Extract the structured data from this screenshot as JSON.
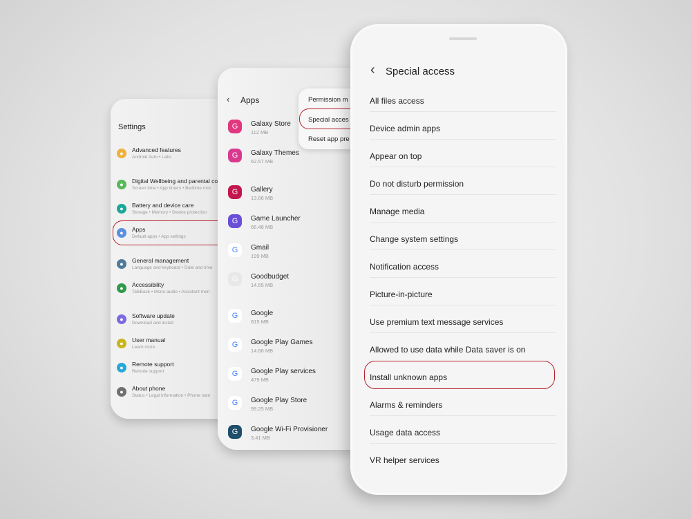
{
  "settings": {
    "title": "Settings",
    "items": [
      {
        "label": "Advanced features",
        "sub": "Android Auto  •  Labs",
        "color": "#f0b13c",
        "icon": "gear-plus-icon"
      },
      {
        "label": "Digital Wellbeing and parental co",
        "sub": "Screen time  •  App timers  •  Bedtime moc",
        "color": "#5bb85d",
        "icon": "wellbeing-icon"
      },
      {
        "label": "Battery and device care",
        "sub": "Storage  •  Memory  •  Device protection",
        "color": "#1aa89a",
        "icon": "battery-care-icon"
      },
      {
        "label": "Apps",
        "sub": "Default apps  •  App settings",
        "color": "#5b8fe0",
        "icon": "apps-grid-icon"
      },
      {
        "label": "General management",
        "sub": "Language and keyboard  •  Date and time",
        "color": "#4f7a99",
        "icon": "sliders-icon"
      },
      {
        "label": "Accessibility",
        "sub": "TalkBack  •  Mono audio  •  Assistant men",
        "color": "#2e9a4a",
        "icon": "accessibility-icon"
      },
      {
        "label": "Software update",
        "sub": "Download and install",
        "color": "#7a6be0",
        "icon": "software-update-icon"
      },
      {
        "label": "User manual",
        "sub": "Learn more",
        "color": "#c9b51e",
        "icon": "manual-icon"
      },
      {
        "label": "Remote support",
        "sub": "Remote support",
        "color": "#27a9d8",
        "icon": "headset-icon"
      },
      {
        "label": "About phone",
        "sub": "Status  •  Legal information  •  Phone nam",
        "color": "#707070",
        "icon": "info-icon"
      }
    ]
  },
  "apps": {
    "title": "Apps",
    "menu": [
      "Permission m",
      "Special acces",
      "Reset app pre"
    ],
    "items": [
      {
        "label": "Galaxy Store",
        "size": "112 MB",
        "color": "#e2367f",
        "icon": "bag-icon"
      },
      {
        "label": "Galaxy Themes",
        "size": "62.57 MB",
        "color": "#d93a90",
        "icon": "brush-icon"
      },
      {
        "label": "Gallery",
        "size": "13.66 MB",
        "color": "#c4164f",
        "icon": "flower-icon"
      },
      {
        "label": "Game Launcher",
        "size": "66.48 MB",
        "color": "#6b4fd8",
        "icon": "game-icon"
      },
      {
        "label": "Gmail",
        "size": "199 MB",
        "color": "#ffffff",
        "icon": "gmail-icon"
      },
      {
        "label": "Goodbudget",
        "size": "14.65 MB",
        "color": "#e8e8e8",
        "icon": "goodbudget-icon"
      },
      {
        "label": "Google",
        "size": "815 MB",
        "color": "#ffffff",
        "icon": "google-icon"
      },
      {
        "label": "Google Play Games",
        "size": "14.66 MB",
        "color": "#ffffff",
        "icon": "play-games-icon"
      },
      {
        "label": "Google Play services",
        "size": "479 MB",
        "color": "#ffffff",
        "icon": "play-services-icon"
      },
      {
        "label": "Google Play Store",
        "size": "99.25 MB",
        "color": "#ffffff",
        "icon": "play-store-icon"
      },
      {
        "label": "Google Wi-Fi Provisioner",
        "size": "3.41 MB",
        "color": "#1f4f6a",
        "icon": "android-icon"
      }
    ]
  },
  "special": {
    "title": "Special access",
    "items": [
      "All files access",
      "Device admin apps",
      "Appear on top",
      "Do not disturb permission",
      "Manage media",
      "Change system settings",
      "Notification access",
      "Picture-in-picture",
      "Use premium text message services",
      "Allowed to use data while Data saver is on",
      "Install unknown apps",
      "Alarms & reminders",
      "Usage data access",
      "VR helper services"
    ],
    "highlighted": "Install unknown apps"
  },
  "accent": "#b3202c"
}
